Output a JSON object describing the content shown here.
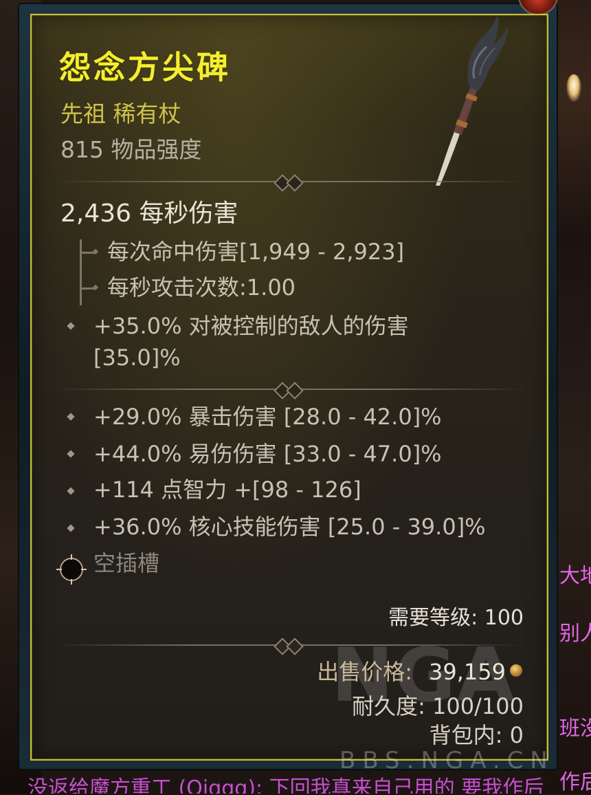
{
  "item": {
    "name": "怨念方尖碑",
    "type_line": "先祖 稀有杖",
    "item_power": "815 物品强度",
    "dps": "2,436 每秒伤害",
    "damage_per_hit": "每次命中伤害[1,949 - 2,923]",
    "attacks_per_second": "每秒攻击次数:1.00",
    "implicit": [
      "+35.0% 对被控制的敌人的伤害",
      "[35.0]%"
    ],
    "affixes": [
      "+29.0% 暴击伤害 [28.0 - 42.0]%",
      "+44.0% 易伤伤害 [33.0 - 47.0]%",
      "+114 点智力 +[98 - 126]",
      "+36.0% 核心技能伤害 [25.0 - 39.0]%"
    ],
    "socket_label": "空插槽",
    "required_level": "需要等级: 100",
    "sell_label": "出售价格:",
    "sell_value": "39,159",
    "durability": "耐久度: 100/100",
    "in_bag": "背包内: 0"
  },
  "background": {
    "side_lines": [
      "大地",
      "别人",
      "班没",
      "作后"
    ],
    "bottom_line": "没返给魔方重工 (Qiqqq): 下回我真来自己用的 要我作后"
  },
  "watermark": {
    "logo": "NGA",
    "site": "BBS.NGA.CN"
  },
  "colors": {
    "title": "#f5ee2e",
    "type_line": "#cfc24a",
    "border": "#c9bd3a",
    "chat": "#e066e6"
  },
  "icons": [
    "staff-icon",
    "socket-icon",
    "gold-coin-icon",
    "bullet-diamond-icon"
  ]
}
